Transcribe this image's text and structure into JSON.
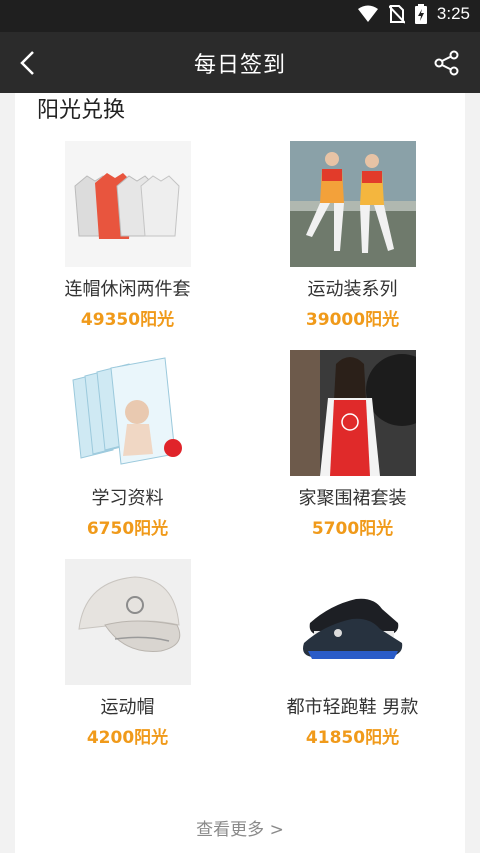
{
  "status": {
    "time": "3:25"
  },
  "header": {
    "title": "每日签到"
  },
  "section": {
    "title": "阳光兑换"
  },
  "items": [
    {
      "name": "连帽休闲两件套",
      "price": "49350阳光"
    },
    {
      "name": "运动装系列",
      "price": "39000阳光"
    },
    {
      "name": "学习资料",
      "price": "6750阳光"
    },
    {
      "name": "家聚围裙套装",
      "price": "5700阳光"
    },
    {
      "name": "运动帽",
      "price": "4200阳光"
    },
    {
      "name": "都市轻跑鞋 男款",
      "price": "41850阳光"
    }
  ],
  "more": {
    "label": "查看更多 >"
  },
  "colors": {
    "price": "#f09a1a",
    "appbar": "#2b2b2b",
    "statusbar": "#1f1f1f"
  }
}
